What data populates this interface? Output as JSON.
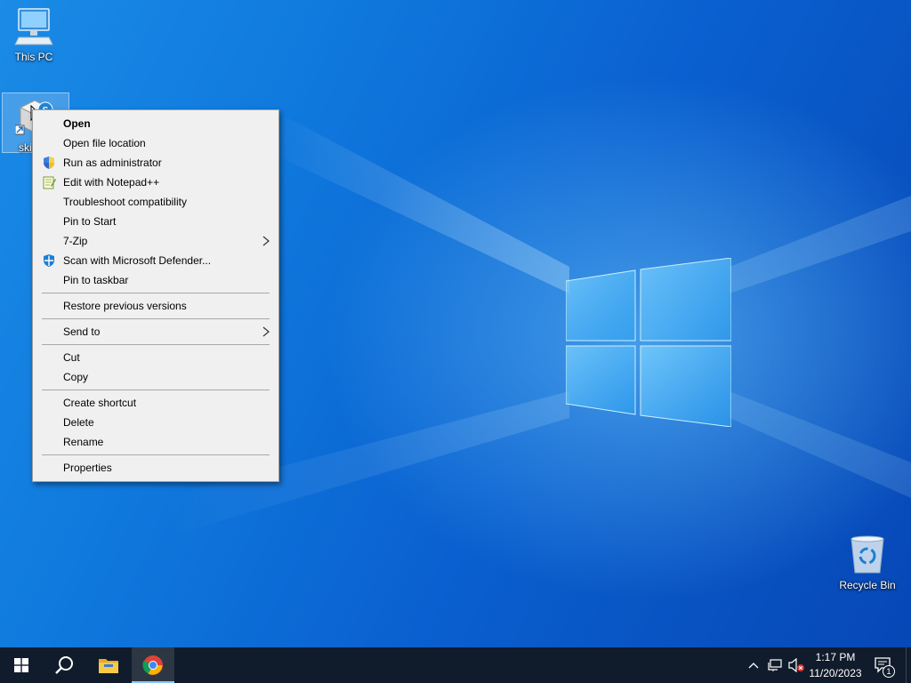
{
  "desktop": {
    "icons": [
      {
        "label": "This PC",
        "icon": "computer-icon"
      },
      {
        "label": "ski",
        "icon": "skype-shortcut-icon"
      },
      {
        "label": "Recycle Bin",
        "icon": "recycle-bin-icon"
      }
    ]
  },
  "context_menu": {
    "items": [
      {
        "label": "Open",
        "bold": true
      },
      {
        "label": "Open file location"
      },
      {
        "label": "Run as administrator",
        "icon": "uac-shield-icon"
      },
      {
        "label": "Edit with Notepad++",
        "icon": "notepad-plus-plus-icon"
      },
      {
        "label": "Troubleshoot compatibility"
      },
      {
        "label": "Pin to Start"
      },
      {
        "label": "7-Zip",
        "submenu": true
      },
      {
        "label": "Scan with Microsoft Defender...",
        "icon": "defender-icon"
      },
      {
        "label": "Pin to taskbar"
      },
      {
        "label": "Restore previous versions"
      },
      {
        "label": "Send to",
        "submenu": true
      },
      {
        "label": "Cut"
      },
      {
        "label": "Copy"
      },
      {
        "label": "Create shortcut"
      },
      {
        "label": "Delete"
      },
      {
        "label": "Rename"
      },
      {
        "label": "Properties"
      }
    ]
  },
  "taskbar": {
    "pinned": [
      "start-icon",
      "search-icon",
      "file-explorer-icon",
      "chrome-icon"
    ],
    "tray": [
      "show-hidden-icons-icon",
      "network-icon",
      "volume-muted-icon"
    ],
    "clock": {
      "time": "1:17 PM",
      "date": "11/20/2023"
    },
    "notifications_count": "1"
  },
  "colors": {
    "taskbar_bg": "#101c2b",
    "menu_bg": "#f0f0f0",
    "accent": "#0a6fd8"
  }
}
